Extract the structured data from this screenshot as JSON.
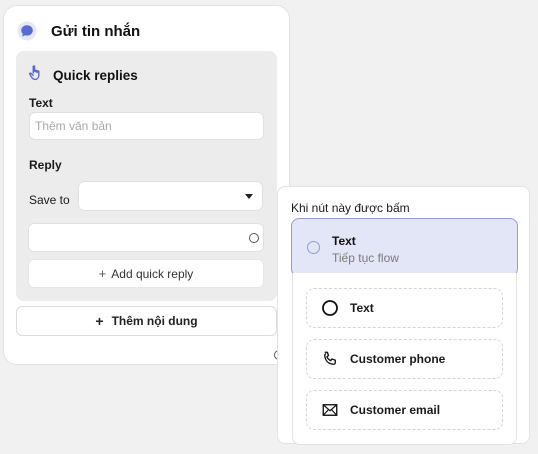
{
  "card": {
    "title": "Gửi tin nhắn",
    "quick_replies": {
      "title": "Quick replies",
      "text_label": "Text",
      "text_placeholder": "Thêm văn bản",
      "reply_label": "Reply",
      "save_to_label": "Save to",
      "save_to_value": "",
      "add_quick_reply_label": "Add quick reply"
    },
    "add_content_label": "Thêm nội dung"
  },
  "popup": {
    "title": "Khi nút này được bấm",
    "selected": {
      "title": "Text",
      "subtitle": "Tiếp tục flow"
    },
    "options": [
      {
        "label": "Text",
        "icon": "circle-icon"
      },
      {
        "label": "Customer phone",
        "icon": "phone-icon"
      },
      {
        "label": "Customer email",
        "icon": "email-icon"
      }
    ]
  },
  "colors": {
    "accent": "#5b6ad0",
    "selected_bg": "#e3e6f6",
    "selected_border": "#8f9be3"
  }
}
